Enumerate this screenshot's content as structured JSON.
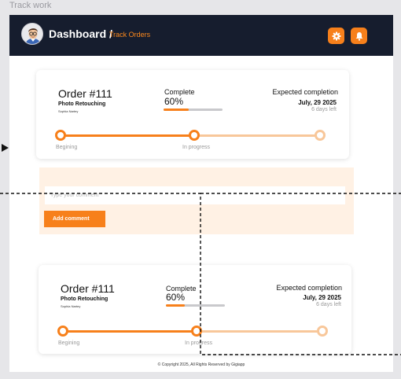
{
  "frame_label": "Track work",
  "header": {
    "title": "Dashboard /",
    "subtitle": "Track Orders",
    "settings_icon": "gear-icon",
    "notifications_icon": "bell-icon"
  },
  "order_cards": [
    {
      "order_title": "Order #111",
      "service": "Photo Retouching",
      "client": "Sophia Nartey",
      "status_label": "Complete",
      "percent": "60%",
      "progress": 0.42,
      "expected_label": "Expected completion",
      "expected_date": "July, 29 2025",
      "days_left": "6 days left",
      "steps": [
        "Begining",
        "In progress"
      ]
    },
    {
      "order_title": "Order #111",
      "service": "Photo Retouching",
      "client": "Sophia Nartey",
      "status_label": "Complete",
      "percent": "60%",
      "progress": 0.32,
      "expected_label": "Expected completion",
      "expected_date": "July, 29 2025",
      "days_left": "6 days left",
      "steps": [
        "Begining",
        "In progress"
      ]
    }
  ],
  "comment": {
    "placeholder": "Type your comment",
    "value": "",
    "button_label": "Add comment"
  },
  "footer": "© Copyright 2025, All Rights Reserved by Gigiapp",
  "colors": {
    "accent": "#f7801b",
    "accent_light": "#f8c79a",
    "header_bg": "#161d2e",
    "panel_bg": "#fff1e4"
  }
}
